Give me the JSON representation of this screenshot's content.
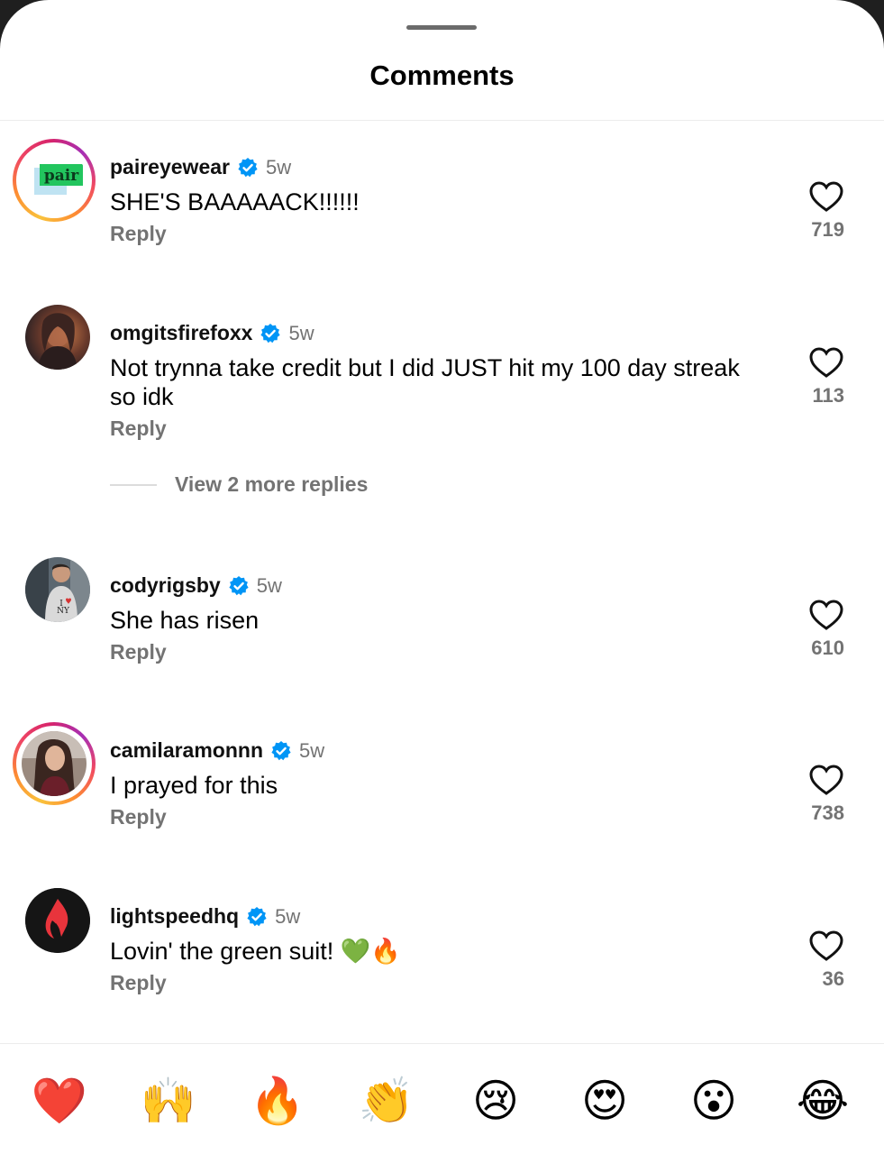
{
  "header": {
    "title": "Comments"
  },
  "comments": [
    {
      "username": "paireyewear",
      "time": "5w",
      "text": "SHE'S BAAAAACK!!!!!!",
      "reply": "Reply",
      "likes": "719",
      "avatar_text": "pair"
    },
    {
      "username": "omgitsfirefoxx",
      "time": "5w",
      "text": "Not trynna take credit but I did JUST hit my 100 day streak so idk",
      "reply": "Reply",
      "likes": "113",
      "more_replies": "View 2 more replies"
    },
    {
      "username": "codyrigsby",
      "time": "5w",
      "text": "She has risen",
      "reply": "Reply",
      "likes": "610"
    },
    {
      "username": "camilaramonnn",
      "time": "5w",
      "text": "I prayed for this",
      "reply": "Reply",
      "likes": "738"
    },
    {
      "username": "lightspeedhq",
      "time": "5w",
      "text": "Lovin' the green suit! 💚🔥",
      "reply": "Reply",
      "likes": "36"
    }
  ],
  "reactions": [
    "❤️",
    "🙌",
    "🔥",
    "👏",
    "😢",
    "😍",
    "😮",
    "😂"
  ],
  "colors": {
    "verified": "#0095f6",
    "secondary_text": "#737373",
    "heart": "#000000"
  }
}
